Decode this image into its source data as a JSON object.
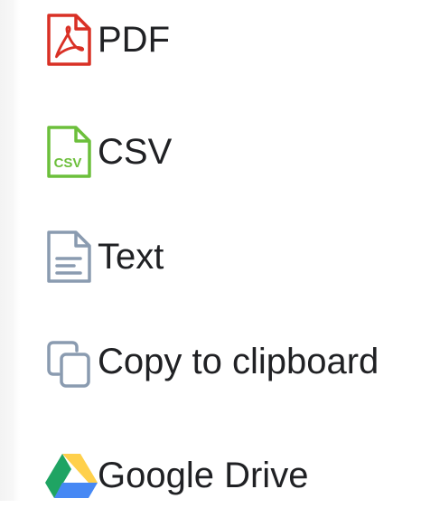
{
  "menu": {
    "items": [
      {
        "label": "PDF",
        "icon": "pdf-file-icon",
        "color": "#d93025"
      },
      {
        "label": "CSV",
        "icon": "csv-file-icon",
        "color": "#6cbf3b",
        "icon_text": "CSV"
      },
      {
        "label": "Text",
        "icon": "text-file-icon",
        "color": "#8a9bb0"
      },
      {
        "label": "Copy to clipboard",
        "icon": "copy-icon",
        "color": "#8a9bb0"
      },
      {
        "label": "Google Drive",
        "icon": "google-drive-icon",
        "colors": [
          "#1fa463",
          "#ffd04b",
          "#4688f4"
        ]
      }
    ]
  }
}
